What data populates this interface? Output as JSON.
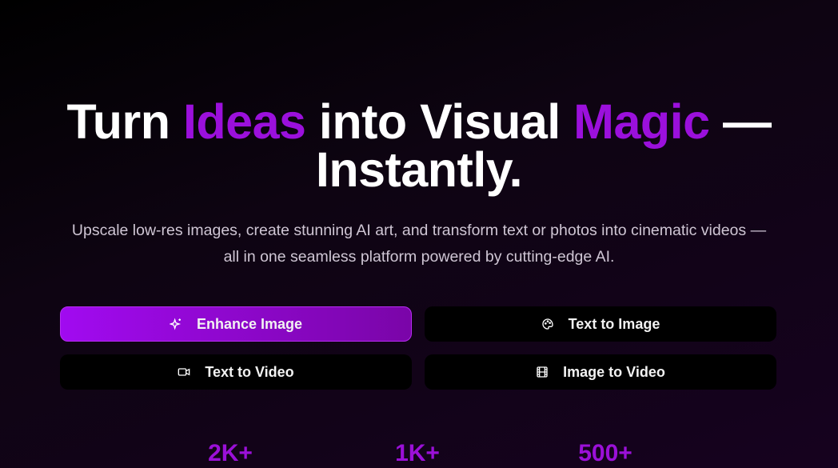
{
  "hero": {
    "title_parts": [
      "Turn ",
      "Ideas",
      " into Visual ",
      "Magic",
      " —"
    ],
    "title_line2": "Instantly.",
    "subtitle": "Upscale low-res images, create stunning AI art, and transform text or photos into cinematic videos — all in one seamless platform powered by cutting-edge AI."
  },
  "modes": [
    {
      "label": "Enhance Image",
      "icon": "sparkles-icon"
    },
    {
      "label": "Text to Image",
      "icon": "palette-icon"
    },
    {
      "label": "Text to Video",
      "icon": "video-camera-icon"
    },
    {
      "label": "Image to Video",
      "icon": "film-icon"
    }
  ],
  "stats": [
    "2K+",
    "1K+",
    "500+"
  ],
  "colors": {
    "accent": "#9b10dc"
  }
}
